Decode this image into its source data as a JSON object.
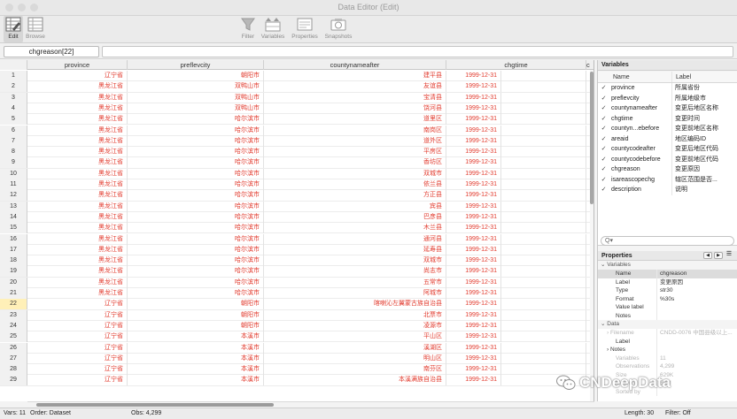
{
  "window": {
    "title": "Data Editor (Edit)"
  },
  "toolbar": {
    "edit": "Edit",
    "browse": "Browse",
    "filter": "Filter",
    "variables": "Variables",
    "properties": "Properties",
    "snapshots": "Snapshots"
  },
  "cell_ref": "chgreason[22]",
  "columns": [
    "province",
    "preflevcity",
    "countynameafter",
    "chgtime",
    "c"
  ],
  "rows": [
    [
      "1",
      "辽宁省",
      "朝阳市",
      "建平县",
      "1999-12-31"
    ],
    [
      "2",
      "黑龙江省",
      "双鸭山市",
      "友谊县",
      "1999-12-31"
    ],
    [
      "3",
      "黑龙江省",
      "双鸭山市",
      "宝清县",
      "1999-12-31"
    ],
    [
      "4",
      "黑龙江省",
      "双鸭山市",
      "饶河县",
      "1999-12-31"
    ],
    [
      "5",
      "黑龙江省",
      "哈尔滨市",
      "道里区",
      "1999-12-31"
    ],
    [
      "6",
      "黑龙江省",
      "哈尔滨市",
      "南岗区",
      "1999-12-31"
    ],
    [
      "7",
      "黑龙江省",
      "哈尔滨市",
      "道外区",
      "1999-12-31"
    ],
    [
      "8",
      "黑龙江省",
      "哈尔滨市",
      "平房区",
      "1999-12-31"
    ],
    [
      "9",
      "黑龙江省",
      "哈尔滨市",
      "香坊区",
      "1999-12-31"
    ],
    [
      "10",
      "黑龙江省",
      "哈尔滨市",
      "双城市",
      "1999-12-31"
    ],
    [
      "11",
      "黑龙江省",
      "哈尔滨市",
      "依兰县",
      "1999-12-31"
    ],
    [
      "12",
      "黑龙江省",
      "哈尔滨市",
      "方正县",
      "1999-12-31"
    ],
    [
      "13",
      "黑龙江省",
      "哈尔滨市",
      "宾县",
      "1999-12-31"
    ],
    [
      "14",
      "黑龙江省",
      "哈尔滨市",
      "巴彦县",
      "1999-12-31"
    ],
    [
      "15",
      "黑龙江省",
      "哈尔滨市",
      "木兰县",
      "1999-12-31"
    ],
    [
      "16",
      "黑龙江省",
      "哈尔滨市",
      "通河县",
      "1999-12-31"
    ],
    [
      "17",
      "黑龙江省",
      "哈尔滨市",
      "延寿县",
      "1999-12-31"
    ],
    [
      "18",
      "黑龙江省",
      "哈尔滨市",
      "双城市",
      "1999-12-31"
    ],
    [
      "19",
      "黑龙江省",
      "哈尔滨市",
      "尚志市",
      "1999-12-31"
    ],
    [
      "20",
      "黑龙江省",
      "哈尔滨市",
      "五常市",
      "1999-12-31"
    ],
    [
      "21",
      "黑龙江省",
      "哈尔滨市",
      "阿城市",
      "1999-12-31"
    ],
    [
      "22",
      "辽宁省",
      "朝阳市",
      "喀喇沁左翼蒙古族自治县",
      "1999-12-31"
    ],
    [
      "23",
      "辽宁省",
      "朝阳市",
      "北票市",
      "1999-12-31"
    ],
    [
      "24",
      "辽宁省",
      "朝阳市",
      "凌源市",
      "1999-12-31"
    ],
    [
      "25",
      "辽宁省",
      "本溪市",
      "平山区",
      "1999-12-31"
    ],
    [
      "26",
      "辽宁省",
      "本溪市",
      "溪湖区",
      "1999-12-31"
    ],
    [
      "27",
      "辽宁省",
      "本溪市",
      "明山区",
      "1999-12-31"
    ],
    [
      "28",
      "辽宁省",
      "本溪市",
      "南芬区",
      "1999-12-31"
    ],
    [
      "29",
      "辽宁省",
      "本溪市",
      "本溪满族自治县",
      "1999-12-31"
    ]
  ],
  "selected_row": "22",
  "variables_panel": {
    "title": "Variables",
    "col_name": "Name",
    "col_label": "Label",
    "items": [
      {
        "check": "✓",
        "name": "province",
        "label": "所属省份"
      },
      {
        "check": "✓",
        "name": "preflevcity",
        "label": "所属地级市"
      },
      {
        "check": "✓",
        "name": "countynameafter",
        "label": "变更后地区名称"
      },
      {
        "check": "✓",
        "name": "chgtime",
        "label": "变更时间"
      },
      {
        "check": "✓",
        "name": "countyn...ebefore",
        "label": "变更前地区名称"
      },
      {
        "check": "✓",
        "name": "areaid",
        "label": "地区编码ID"
      },
      {
        "check": "✓",
        "name": "countycodeafter",
        "label": "变更后地区代码"
      },
      {
        "check": "✓",
        "name": "countycodebefore",
        "label": "变更前地区代码"
      },
      {
        "check": "✓",
        "name": "chgreason",
        "label": "变更原因"
      },
      {
        "check": "✓",
        "name": "isareascopechg",
        "label": "辖区范围是否..."
      },
      {
        "check": "✓",
        "name": "description",
        "label": "说明"
      }
    ],
    "search_placeholder": "Q▾"
  },
  "properties_panel": {
    "title": "Properties",
    "nav_prev": "◀",
    "nav_next": "▶",
    "nav_menu": "☰",
    "sec_variables": "⌄ Variables",
    "sec_data": "⌄ Data",
    "var_rows": [
      {
        "k": "Name",
        "v": "chgreason"
      },
      {
        "k": "Label",
        "v": "变更原因"
      },
      {
        "k": "Type",
        "v": "str30"
      },
      {
        "k": "Format",
        "v": "%30s"
      },
      {
        "k": "Value label",
        "v": ""
      },
      {
        "k": "Notes",
        "v": ""
      }
    ],
    "data_rows": [
      {
        "k": "› Filename",
        "v": "CNDD-0076 中国县级以上..."
      },
      {
        "k": "Label",
        "v": ""
      },
      {
        "k": "› Notes",
        "v": ""
      },
      {
        "k": "Variables",
        "v": "11"
      },
      {
        "k": "Observations",
        "v": "4,299"
      },
      {
        "k": "Size",
        "v": "629K"
      },
      {
        "k": "Memory",
        "v": "64M"
      },
      {
        "k": "Sorted by",
        "v": ""
      }
    ]
  },
  "status": {
    "vars": "Vars: 11",
    "order": "Order: Dataset",
    "obs": "Obs: 4,299",
    "length": "Length: 30",
    "filter": "Filter: Off"
  },
  "watermark": "CNDeepData",
  "colors": {
    "cell_text": "#e23b2e",
    "selected_row": "#fff0b8"
  }
}
